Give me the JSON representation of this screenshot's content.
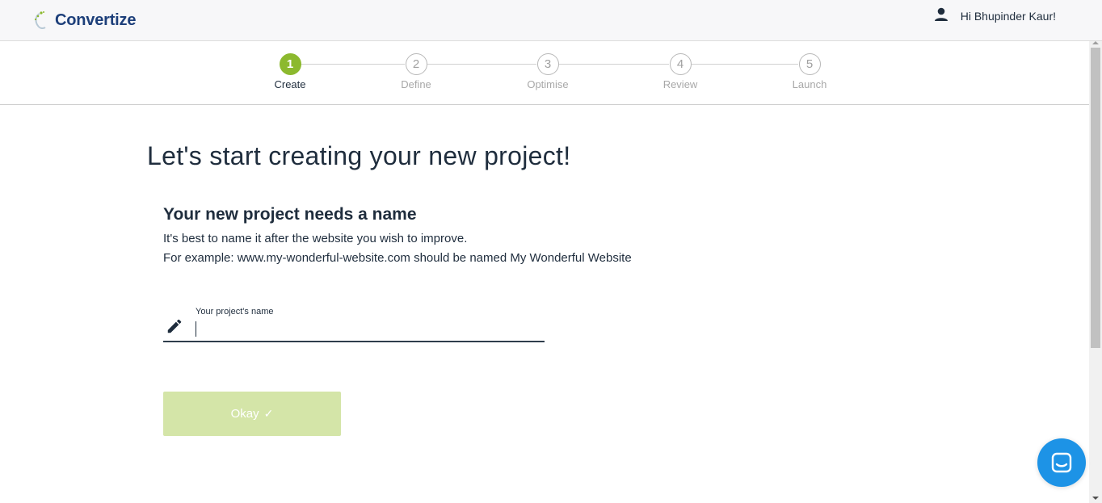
{
  "header": {
    "brand": "Convertize",
    "greeting": "Hi Bhupinder Kaur!"
  },
  "stepper": {
    "steps": [
      {
        "number": "1",
        "label": "Create",
        "active": true
      },
      {
        "number": "2",
        "label": "Define",
        "active": false
      },
      {
        "number": "3",
        "label": "Optimise",
        "active": false
      },
      {
        "number": "4",
        "label": "Review",
        "active": false
      },
      {
        "number": "5",
        "label": "Launch",
        "active": false
      }
    ]
  },
  "main": {
    "title": "Let's start creating your new project!",
    "section_heading": "Your new project needs a name",
    "hint_line1": "It's best to name it after the website you wish to improve.",
    "hint_line2": "For example: www.my-wonderful-website.com should be named My Wonderful Website",
    "field": {
      "label": "Your project's name",
      "value": ""
    },
    "okay_label": "Okay",
    "okay_check": "✓"
  },
  "icons": {
    "logo": "convertize-logo-icon",
    "user": "user-icon",
    "pencil": "pencil-icon",
    "check": "check-icon",
    "chat": "chat-icon"
  },
  "colors": {
    "accent": "#8cb92e",
    "button_disabled": "#d4e5a8",
    "brand": "#1d3f7a",
    "chat": "#1d93e6"
  }
}
